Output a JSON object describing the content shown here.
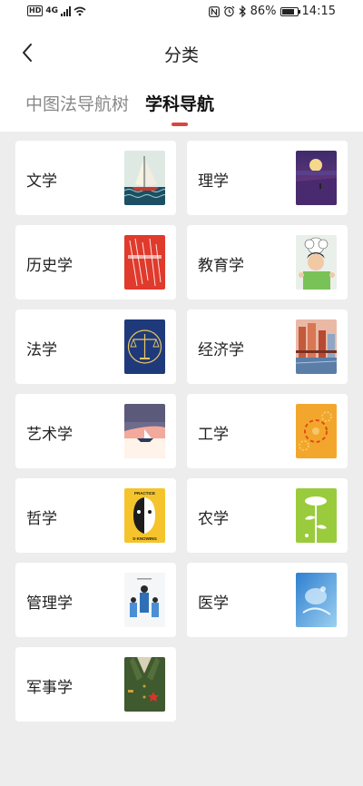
{
  "status_bar": {
    "network_left": "HD",
    "network_gen": "4G",
    "battery_pct": "86%",
    "time": "14:15",
    "battery_level": 0.86
  },
  "header": {
    "title": "分类",
    "back_icon": "chevron-left-icon"
  },
  "tabs": [
    {
      "label": "中图法导航树",
      "active": false
    },
    {
      "label": "学科导航",
      "active": true
    }
  ],
  "subjects": [
    {
      "name": "文学",
      "cover": "sailboat-cover"
    },
    {
      "name": "理学",
      "cover": "moon-cover"
    },
    {
      "name": "历史学",
      "cover": "red-script-cover"
    },
    {
      "name": "教育学",
      "cover": "cartoon-kid-cover"
    },
    {
      "name": "法学",
      "cover": "scales-of-justice-cover"
    },
    {
      "name": "经济学",
      "cover": "city-bridge-cover"
    },
    {
      "name": "艺术学",
      "cover": "boat-sunset-cover"
    },
    {
      "name": "工学",
      "cover": "gears-cover"
    },
    {
      "name": "哲学",
      "cover": "face-mask-cover"
    },
    {
      "name": "农学",
      "cover": "plant-cover"
    },
    {
      "name": "管理学",
      "cover": "business-people-cover"
    },
    {
      "name": "医学",
      "cover": "blue-medical-cover"
    },
    {
      "name": "军事学",
      "cover": "military-uniform-cover"
    }
  ],
  "cover_texts": {
    "philosophy_top": "PRACTICE",
    "philosophy_bottom": "S·KNOWING"
  },
  "colors": {
    "accent": "#d9463b",
    "background": "#ededed",
    "card": "#ffffff"
  }
}
